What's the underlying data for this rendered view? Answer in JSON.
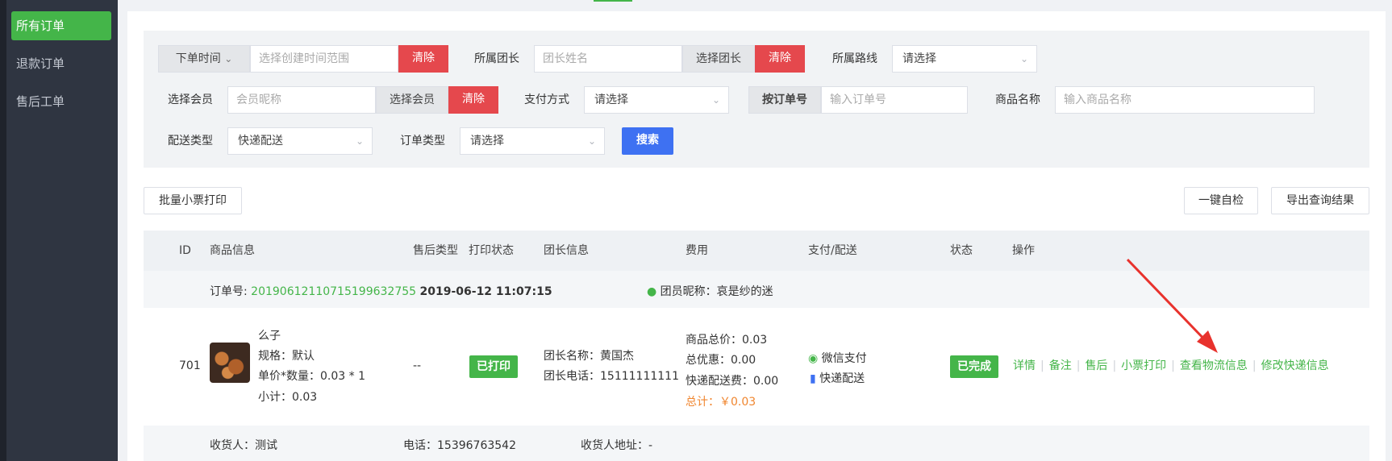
{
  "sidebar": {
    "items": [
      {
        "label": "所有订单",
        "active": true
      },
      {
        "label": "退款订单",
        "active": false
      },
      {
        "label": "售后工单",
        "active": false
      }
    ]
  },
  "filters": {
    "order_time_select": "下单时间",
    "date_range_placeholder": "选择创建时间范围",
    "clear_label": "清除",
    "leader_label": "所属团长",
    "leader_placeholder": "团长姓名",
    "select_leader_label": "选择团长",
    "route_label": "所属路线",
    "route_value": "请选择",
    "member_label": "选择会员",
    "member_placeholder": "会员昵称",
    "select_member_label": "选择会员",
    "payment_label": "支付方式",
    "payment_value": "请选择",
    "order_no_label": "按订单号",
    "order_no_placeholder": "输入订单号",
    "product_name_label": "商品名称",
    "product_name_placeholder": "输入商品名称",
    "delivery_type_label": "配送类型",
    "delivery_type_value": "快递配送",
    "order_type_label": "订单类型",
    "order_type_value": "请选择",
    "search_label": "搜索"
  },
  "toolbar": {
    "batch_print": "批量小票打印",
    "one_click_check": "一键自检",
    "export": "导出查询结果"
  },
  "table": {
    "headers": {
      "id": "ID",
      "product": "商品信息",
      "aftersale": "售后类型",
      "print_status": "打印状态",
      "leader": "团长信息",
      "fees": "费用",
      "pay_delivery": "支付/配送",
      "status": "状态",
      "actions": "操作"
    },
    "order": {
      "order_no_label": "订单号: ",
      "order_no": "20190612110715199632755",
      "datetime": "2019-06-12 11:07:15",
      "member_nickname": "团员昵称：哀是纱的迷",
      "id": "701",
      "product_name": "么子",
      "spec": "规格：默认",
      "price_qty": "单价*数量：0.03 * 1",
      "subtotal": "小计：0.03",
      "aftersale": "--",
      "print_status": "已打印",
      "leader_name": "团长名称：黄国杰",
      "leader_phone": "团长电话：15111111111",
      "goods_total": "商品总价：0.03",
      "discount": "总优惠：0.00",
      "shipping_fee": "快递配送费：0.00",
      "total": "总计：￥0.03",
      "payment": "微信支付",
      "delivery": "快递配送",
      "status": "已完成",
      "actions": [
        "详情",
        "备注",
        "售后",
        "小票打印",
        "查看物流信息",
        "修改快递信息"
      ],
      "receiver": "收货人：测试",
      "phone": "电话：15396763542",
      "address": "收货人地址：-"
    }
  },
  "colors": {
    "accent_green": "#44b549",
    "danger_red": "#e5484d",
    "primary_blue": "#3e71f2",
    "annotation_red": "#e8322d",
    "sidebar_bg": "#2f3541"
  }
}
